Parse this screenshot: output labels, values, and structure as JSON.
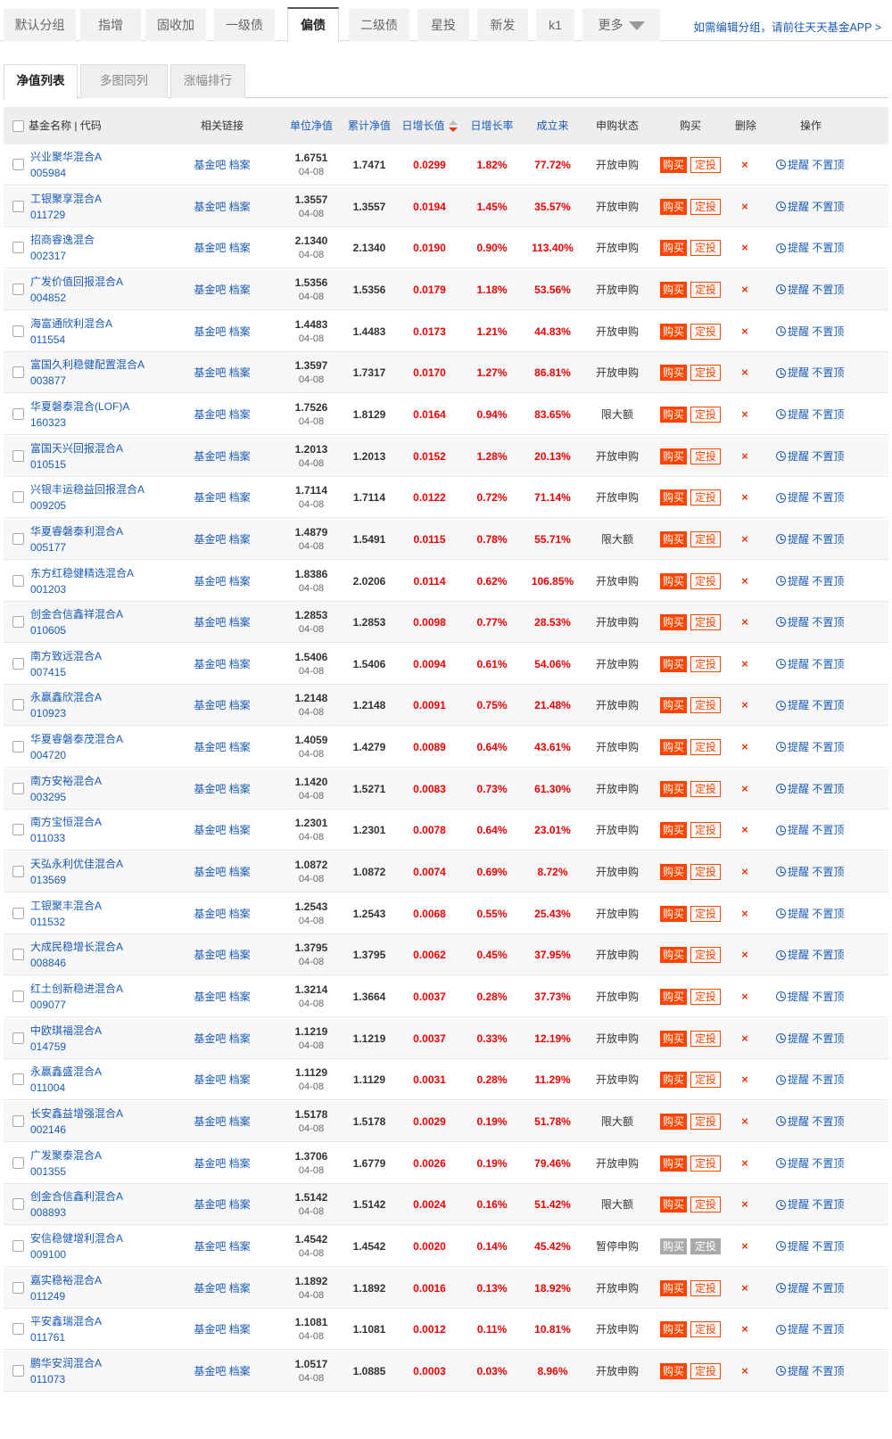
{
  "group_tabs": [
    "默认分组",
    "指增",
    "固收加",
    "一级债",
    "偏债",
    "二级债",
    "星投",
    "新发",
    "k1",
    "更多"
  ],
  "active_group_tab": "偏债",
  "edit_link": "如需编辑分组，请前往天天基金APP >",
  "sub_tabs": [
    "净值列表",
    "多图同列",
    "涨幅排行"
  ],
  "active_sub_tab": "净值列表",
  "columns": {
    "name_code": "基金名称 | 代码",
    "links": "相关链接",
    "nav": "单位净值",
    "acc_nav": "累计净值",
    "daily_value": "日增长值",
    "daily_rate": "日增长率",
    "since_inception": "成立来",
    "purchase_status": "申购状态",
    "buy": "购买",
    "delete": "删除",
    "ops": "操作"
  },
  "link_labels": {
    "bar": "基金吧",
    "archive": "档案"
  },
  "action_labels": {
    "buy": "购买",
    "plan": "定投",
    "remind": "提醒",
    "pin": "不置顶",
    "delete": "×"
  },
  "colors": {
    "link": "#1a5bb5",
    "up": "#e00000",
    "buy": "#ff4400",
    "disabled": "#aaaaaa"
  },
  "rows": [
    {
      "name": "兴业聚华混合A",
      "code": "005984",
      "nav": "1.6751",
      "date": "04-08",
      "acc": "1.7471",
      "chg": "0.0299",
      "pct": "1.82%",
      "since": "77.72%",
      "status": "开放申购",
      "disabled": false
    },
    {
      "name": "工银聚享混合A",
      "code": "011729",
      "nav": "1.3557",
      "date": "04-08",
      "acc": "1.3557",
      "chg": "0.0194",
      "pct": "1.45%",
      "since": "35.57%",
      "status": "开放申购",
      "disabled": false
    },
    {
      "name": "招商睿逸混合",
      "code": "002317",
      "nav": "2.1340",
      "date": "04-08",
      "acc": "2.1340",
      "chg": "0.0190",
      "pct": "0.90%",
      "since": "113.40%",
      "status": "开放申购",
      "disabled": false
    },
    {
      "name": "广发价值回报混合A",
      "code": "004852",
      "nav": "1.5356",
      "date": "04-08",
      "acc": "1.5356",
      "chg": "0.0179",
      "pct": "1.18%",
      "since": "53.56%",
      "status": "开放申购",
      "disabled": false
    },
    {
      "name": "海富通欣利混合A",
      "code": "011554",
      "nav": "1.4483",
      "date": "04-08",
      "acc": "1.4483",
      "chg": "0.0173",
      "pct": "1.21%",
      "since": "44.83%",
      "status": "开放申购",
      "disabled": false
    },
    {
      "name": "富国久利稳健配置混合A",
      "code": "003877",
      "nav": "1.3597",
      "date": "04-08",
      "acc": "1.7317",
      "chg": "0.0170",
      "pct": "1.27%",
      "since": "86.81%",
      "status": "开放申购",
      "disabled": false
    },
    {
      "name": "华夏磐泰混合(LOF)A",
      "code": "160323",
      "nav": "1.7526",
      "date": "04-08",
      "acc": "1.8129",
      "chg": "0.0164",
      "pct": "0.94%",
      "since": "83.65%",
      "status": "限大额",
      "disabled": false
    },
    {
      "name": "富国天兴回报混合A",
      "code": "010515",
      "nav": "1.2013",
      "date": "04-08",
      "acc": "1.2013",
      "chg": "0.0152",
      "pct": "1.28%",
      "since": "20.13%",
      "status": "开放申购",
      "disabled": false
    },
    {
      "name": "兴银丰运稳益回报混合A",
      "code": "009205",
      "nav": "1.7114",
      "date": "04-08",
      "acc": "1.7114",
      "chg": "0.0122",
      "pct": "0.72%",
      "since": "71.14%",
      "status": "开放申购",
      "disabled": false
    },
    {
      "name": "华夏睿磐泰利混合A",
      "code": "005177",
      "nav": "1.4879",
      "date": "04-08",
      "acc": "1.5491",
      "chg": "0.0115",
      "pct": "0.78%",
      "since": "55.71%",
      "status": "限大额",
      "disabled": false
    },
    {
      "name": "东方红稳健精选混合A",
      "code": "001203",
      "nav": "1.8386",
      "date": "04-08",
      "acc": "2.0206",
      "chg": "0.0114",
      "pct": "0.62%",
      "since": "106.85%",
      "status": "开放申购",
      "disabled": false
    },
    {
      "name": "创金合信鑫祥混合A",
      "code": "010605",
      "nav": "1.2853",
      "date": "04-08",
      "acc": "1.2853",
      "chg": "0.0098",
      "pct": "0.77%",
      "since": "28.53%",
      "status": "开放申购",
      "disabled": false
    },
    {
      "name": "南方致远混合A",
      "code": "007415",
      "nav": "1.5406",
      "date": "04-08",
      "acc": "1.5406",
      "chg": "0.0094",
      "pct": "0.61%",
      "since": "54.06%",
      "status": "开放申购",
      "disabled": false
    },
    {
      "name": "永赢鑫欣混合A",
      "code": "010923",
      "nav": "1.2148",
      "date": "04-08",
      "acc": "1.2148",
      "chg": "0.0091",
      "pct": "0.75%",
      "since": "21.48%",
      "status": "开放申购",
      "disabled": false
    },
    {
      "name": "华夏睿磐泰茂混合A",
      "code": "004720",
      "nav": "1.4059",
      "date": "04-08",
      "acc": "1.4279",
      "chg": "0.0089",
      "pct": "0.64%",
      "since": "43.61%",
      "status": "开放申购",
      "disabled": false
    },
    {
      "name": "南方安裕混合A",
      "code": "003295",
      "nav": "1.1420",
      "date": "04-08",
      "acc": "1.5271",
      "chg": "0.0083",
      "pct": "0.73%",
      "since": "61.30%",
      "status": "开放申购",
      "disabled": false
    },
    {
      "name": "南方宝恒混合A",
      "code": "011033",
      "nav": "1.2301",
      "date": "04-08",
      "acc": "1.2301",
      "chg": "0.0078",
      "pct": "0.64%",
      "since": "23.01%",
      "status": "开放申购",
      "disabled": false
    },
    {
      "name": "天弘永利优佳混合A",
      "code": "013569",
      "nav": "1.0872",
      "date": "04-08",
      "acc": "1.0872",
      "chg": "0.0074",
      "pct": "0.69%",
      "since": "8.72%",
      "status": "开放申购",
      "disabled": false
    },
    {
      "name": "工银聚丰混合A",
      "code": "011532",
      "nav": "1.2543",
      "date": "04-08",
      "acc": "1.2543",
      "chg": "0.0068",
      "pct": "0.55%",
      "since": "25.43%",
      "status": "开放申购",
      "disabled": false
    },
    {
      "name": "大成民稳增长混合A",
      "code": "008846",
      "nav": "1.3795",
      "date": "04-08",
      "acc": "1.3795",
      "chg": "0.0062",
      "pct": "0.45%",
      "since": "37.95%",
      "status": "开放申购",
      "disabled": false
    },
    {
      "name": "红土创新稳进混合A",
      "code": "009077",
      "nav": "1.3214",
      "date": "04-08",
      "acc": "1.3664",
      "chg": "0.0037",
      "pct": "0.28%",
      "since": "37.73%",
      "status": "开放申购",
      "disabled": false
    },
    {
      "name": "中欧琪福混合A",
      "code": "014759",
      "nav": "1.1219",
      "date": "04-08",
      "acc": "1.1219",
      "chg": "0.0037",
      "pct": "0.33%",
      "since": "12.19%",
      "status": "开放申购",
      "disabled": false
    },
    {
      "name": "永赢鑫盛混合A",
      "code": "011004",
      "nav": "1.1129",
      "date": "04-08",
      "acc": "1.1129",
      "chg": "0.0031",
      "pct": "0.28%",
      "since": "11.29%",
      "status": "开放申购",
      "disabled": false
    },
    {
      "name": "长安鑫益增强混合A",
      "code": "002146",
      "nav": "1.5178",
      "date": "04-08",
      "acc": "1.5178",
      "chg": "0.0029",
      "pct": "0.19%",
      "since": "51.78%",
      "status": "限大额",
      "disabled": false
    },
    {
      "name": "广发聚泰混合A",
      "code": "001355",
      "nav": "1.3706",
      "date": "04-08",
      "acc": "1.6779",
      "chg": "0.0026",
      "pct": "0.19%",
      "since": "79.46%",
      "status": "开放申购",
      "disabled": false
    },
    {
      "name": "创金合信鑫利混合A",
      "code": "008893",
      "nav": "1.5142",
      "date": "04-08",
      "acc": "1.5142",
      "chg": "0.0024",
      "pct": "0.16%",
      "since": "51.42%",
      "status": "限大额",
      "disabled": false
    },
    {
      "name": "安信稳健增利混合A",
      "code": "009100",
      "nav": "1.4542",
      "date": "04-08",
      "acc": "1.4542",
      "chg": "0.0020",
      "pct": "0.14%",
      "since": "45.42%",
      "status": "暂停申购",
      "disabled": true
    },
    {
      "name": "嘉实稳裕混合A",
      "code": "011249",
      "nav": "1.1892",
      "date": "04-08",
      "acc": "1.1892",
      "chg": "0.0016",
      "pct": "0.13%",
      "since": "18.92%",
      "status": "开放申购",
      "disabled": false
    },
    {
      "name": "平安鑫瑞混合A",
      "code": "011761",
      "nav": "1.1081",
      "date": "04-08",
      "acc": "1.1081",
      "chg": "0.0012",
      "pct": "0.11%",
      "since": "10.81%",
      "status": "开放申购",
      "disabled": false
    },
    {
      "name": "鹏华安润混合A",
      "code": "011073",
      "nav": "1.0517",
      "date": "04-08",
      "acc": "1.0885",
      "chg": "0.0003",
      "pct": "0.03%",
      "since": "8.96%",
      "status": "开放申购",
      "disabled": false
    }
  ]
}
